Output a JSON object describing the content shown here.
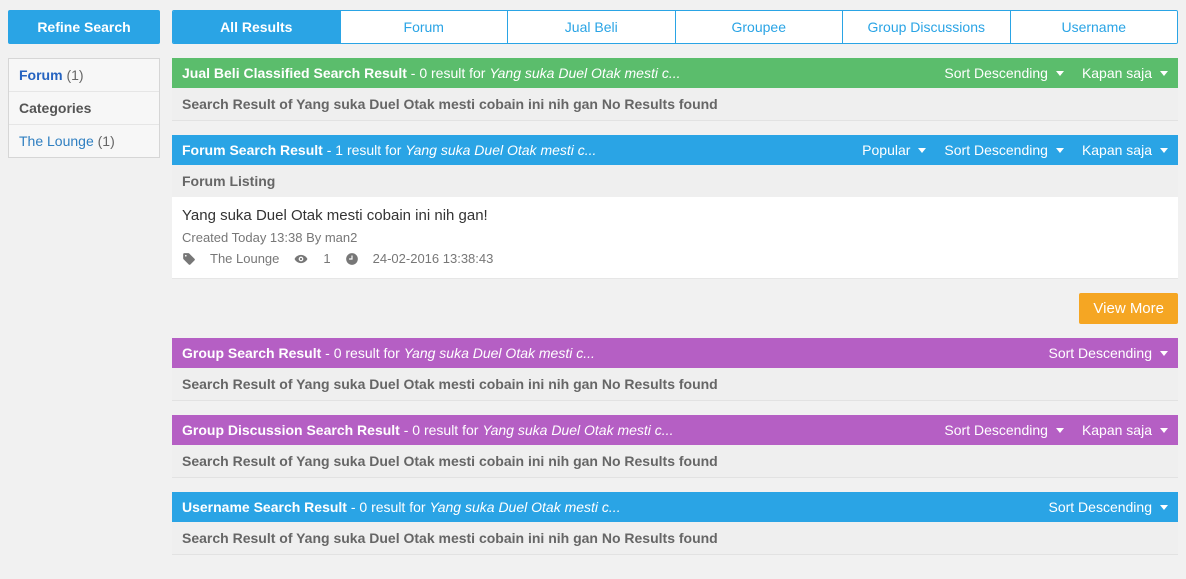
{
  "sidebar": {
    "refine_label": "Refine Search",
    "rows": [
      {
        "label": "Forum",
        "count": "(1)",
        "cls": "active"
      },
      {
        "label": "Categories",
        "count": "",
        "cls": "normal"
      },
      {
        "label": "The Lounge",
        "count": "(1)",
        "cls": "link"
      }
    ]
  },
  "tabs": [
    {
      "label": "All Results",
      "active": true
    },
    {
      "label": "Forum",
      "active": false
    },
    {
      "label": "Jual Beli",
      "active": false
    },
    {
      "label": "Groupee",
      "active": false
    },
    {
      "label": "Group Discussions",
      "active": false
    },
    {
      "label": "Username",
      "active": false
    }
  ],
  "sections": {
    "jualbeli": {
      "title": "Jual Beli Classified Search Result",
      "sub": " - 0 result for ",
      "query": "Yang suka Duel Otak mesti c...",
      "noresult": "Search Result of Yang suka Duel Otak mesti cobain ini nih gan No Results found",
      "sort": "Sort Descending",
      "time": "Kapan saja"
    },
    "forum": {
      "title": "Forum Search Result",
      "sub": " - 1 result for ",
      "query": "Yang suka Duel Otak mesti c...",
      "listing_head": "Forum Listing",
      "item": {
        "title": "Yang suka Duel Otak mesti cobain ini nih gan!",
        "created": "Created Today 13:38 By man2",
        "category": "The Lounge",
        "views": "1",
        "timestamp": "24-02-2016 13:38:43"
      },
      "popular": "Popular",
      "sort": "Sort Descending",
      "time": "Kapan saja",
      "view_more": "View More"
    },
    "group": {
      "title": "Group Search Result",
      "sub": " - 0 result for ",
      "query": "Yang suka Duel Otak mesti c...",
      "noresult": "Search Result of Yang suka Duel Otak mesti cobain ini nih gan No Results found",
      "sort": "Sort Descending"
    },
    "discussion": {
      "title": "Group Discussion Search Result",
      "sub": " - 0 result for ",
      "query": "Yang suka Duel Otak mesti c...",
      "noresult": "Search Result of Yang suka Duel Otak mesti cobain ini nih gan No Results found",
      "sort": "Sort Descending",
      "time": "Kapan saja"
    },
    "username": {
      "title": "Username Search Result",
      "sub": " - 0 result for ",
      "query": "Yang suka Duel Otak mesti c...",
      "noresult": "Search Result of Yang suka Duel Otak mesti cobain ini nih gan No Results found",
      "sort": "Sort Descending"
    }
  }
}
